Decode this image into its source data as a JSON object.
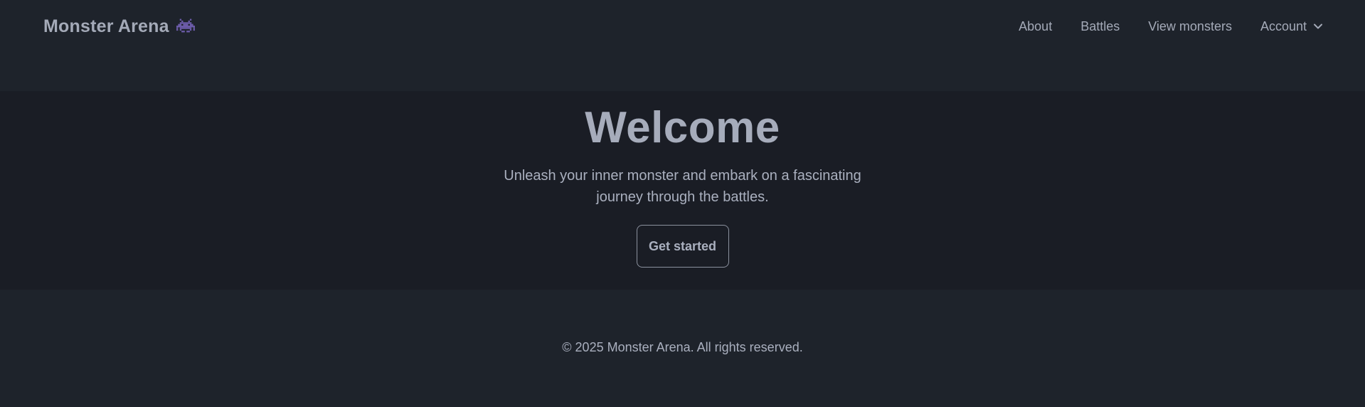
{
  "header": {
    "brand": "Monster Arena",
    "brand_icon": "space-invader-icon",
    "nav": [
      {
        "label": "About"
      },
      {
        "label": "Battles"
      },
      {
        "label": "View monsters"
      },
      {
        "label": "Account",
        "icon": "chevron-down-icon"
      }
    ]
  },
  "hero": {
    "title": "Welcome",
    "subtitle": "Unleash your inner monster and embark on a fascinating journey through the battles.",
    "cta_label": "Get started"
  },
  "footer": {
    "copyright": "© 2025 Monster Arena. All rights reserved."
  },
  "colors": {
    "background": "#1e232b",
    "hero_background": "#1a1d25",
    "text": "#aab0bf",
    "brand_icon": "#6b5ba8"
  }
}
